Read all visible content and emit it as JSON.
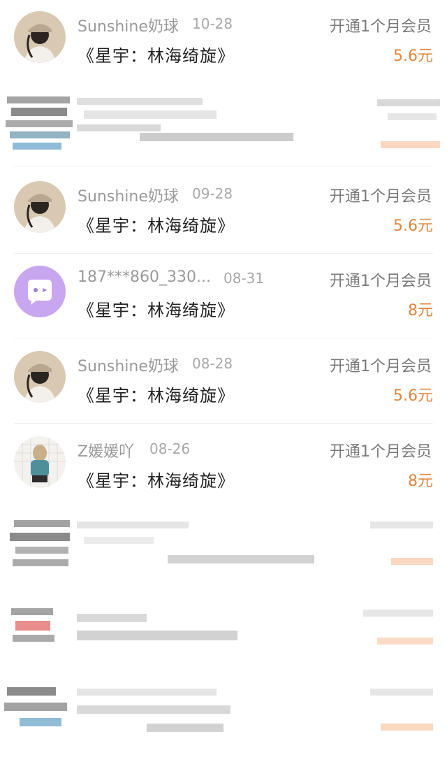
{
  "records": [
    {
      "name": "Sunshine奶球",
      "date": "10-28",
      "plan": "开通1个月会员",
      "book": "《星宇：林海绮旋》",
      "price": "5.6元",
      "avatar": "girl-cap-avatar"
    },
    {
      "name": "Sunshine奶球",
      "date": "09-28",
      "plan": "开通1个月会员",
      "book": "《星宇：林海绮旋》",
      "price": "5.6元",
      "avatar": "girl-cap-avatar"
    },
    {
      "name": "187***860_330...",
      "date": "08-31",
      "plan": "开通1个月会员",
      "book": "《星宇：林海绮旋》",
      "price": "8元",
      "avatar": "chat-bubble-avatar"
    },
    {
      "name": "Sunshine奶球",
      "date": "08-28",
      "plan": "开通1个月会员",
      "book": "《星宇：林海绮旋》",
      "price": "5.6元",
      "avatar": "girl-cap-avatar"
    },
    {
      "name": "Z媛媛吖",
      "date": "08-26",
      "plan": "开通1个月会员",
      "book": "《星宇：林海绮旋》",
      "price": "8元",
      "avatar": "girl-backpack-avatar"
    }
  ],
  "colors": {
    "price": "#e0853d",
    "name": "#9a9a9a",
    "divider": "#eeeeee",
    "chat_avatar_bg": "#c9a6f0"
  }
}
